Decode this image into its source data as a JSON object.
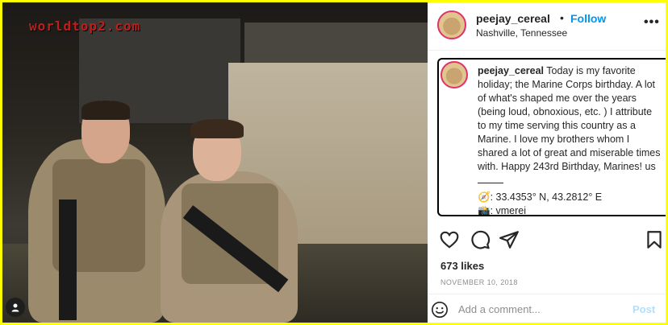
{
  "photo": {
    "watermark": "worldtop2.com",
    "tag_icon": "person-tag-icon"
  },
  "header": {
    "username": "peejay_cereal",
    "separator": "•",
    "follow_label": "Follow",
    "location": "Nashville, Tennessee",
    "more_label": "•••"
  },
  "caption": {
    "username": "peejay_cereal",
    "text": "Today is my favorite holiday; the Marine Corps birthday. A lot of what's shaped me over the years (being loud, obnoxious, etc. ) I attribute to my time serving this country as a Marine. I love my brothers whom I shared a lot of great and miserable times with. Happy 243rd Birthday, Marines! us",
    "coords_icon": "🧭",
    "coords": ": 33.4353° N, 43.2812° E",
    "credit_icon": "📸",
    "credit": ": vmerei"
  },
  "actions": {
    "icons": [
      "heart-icon",
      "comment-icon",
      "share-icon",
      "bookmark-icon"
    ]
  },
  "likes": "673 likes",
  "date": "NOVEMBER 10, 2018",
  "comment": {
    "placeholder": "Add a comment...",
    "post_label": "Post"
  },
  "colors": {
    "border": "#ffff00",
    "follow": "#0095f6",
    "post_disabled": "#b2dffc",
    "watermark": "#c21d1d"
  }
}
